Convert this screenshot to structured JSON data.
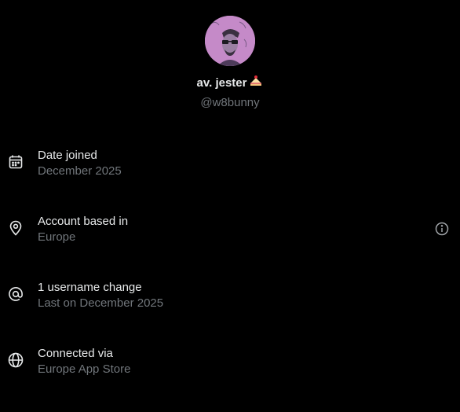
{
  "profile": {
    "display_name": "av. jester",
    "handle": "@w8bunny",
    "avatar_bg": "#c58ac8"
  },
  "rows": [
    {
      "icon": "calendar-icon",
      "title": "Date joined",
      "subtitle": "December 2025"
    },
    {
      "icon": "location-pin-icon",
      "title": "Account based in",
      "subtitle": "Europe",
      "trailing_icon": "info-icon"
    },
    {
      "icon": "at-sign-icon",
      "title": "1 username change",
      "subtitle": "Last on December 2025"
    },
    {
      "icon": "globe-icon",
      "title": "Connected via",
      "subtitle": "Europe App Store"
    }
  ],
  "colors": {
    "background": "#000000",
    "primary_text": "#e7e9ea",
    "secondary_text": "#71767b"
  }
}
